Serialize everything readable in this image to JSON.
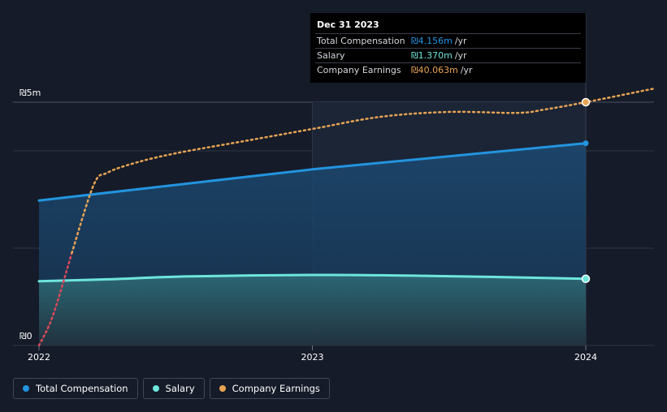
{
  "colors": {
    "background": "#151b28",
    "total": "#2394df",
    "salary": "#6ee6dc",
    "earnings": "#e9a453",
    "earnings_negative": "#e0475a",
    "grid": "#2d3445"
  },
  "tooltip": {
    "date": "Dec 31 2023",
    "rows": [
      {
        "label": "Total Compensation",
        "value": "₪4.156m",
        "unit": "/yr",
        "color": "#2394df"
      },
      {
        "label": "Salary",
        "value": "₪1.370m",
        "unit": "/yr",
        "color": "#6ee6dc"
      },
      {
        "label": "Company Earnings",
        "value": "₪40.063m",
        "unit": "/yr",
        "color": "#e9a453"
      }
    ]
  },
  "legend": [
    {
      "label": "Total Compensation",
      "color": "#2394df"
    },
    {
      "label": "Salary",
      "color": "#6ee6dc"
    },
    {
      "label": "Company Earnings",
      "color": "#e9a453"
    }
  ],
  "chart_data": {
    "type": "area",
    "title": "",
    "xlabel": "",
    "ylabel": "",
    "x_ticks": [
      "2022",
      "2023",
      "2024"
    ],
    "y_ticks": [
      "₪0",
      "₪5m"
    ],
    "y_tick_values": [
      0,
      5
    ],
    "xlim": [
      2022.0,
      2024.25
    ],
    "ylim": [
      0,
      5
    ],
    "grid": true,
    "legend_position": "bottom-left",
    "highlight_x": 2024.0,
    "series": [
      {
        "name": "Total Compensation",
        "x": [
          2022.0,
          2023.0,
          2024.0
        ],
        "y": [
          2.98,
          3.62,
          4.156
        ]
      },
      {
        "name": "Salary",
        "x": [
          2022.0,
          2022.25,
          2022.55,
          2023.0,
          2023.3,
          2023.65,
          2024.0
        ],
        "y": [
          1.32,
          1.36,
          1.42,
          1.45,
          1.44,
          1.41,
          1.37
        ]
      },
      {
        "name": "Company Earnings",
        "x": [
          2022.0,
          2022.05,
          2022.12,
          2022.2,
          2022.25,
          2022.35,
          2022.5,
          2022.75,
          2023.0,
          2023.25,
          2023.5,
          2023.75,
          2023.85,
          2024.0,
          2024.25
        ],
        "y": [
          0.0,
          0.6,
          1.9,
          3.3,
          3.55,
          3.75,
          3.95,
          4.2,
          4.45,
          4.7,
          4.8,
          4.78,
          4.85,
          5.0,
          5.28
        ],
        "negative_until": 2022.06
      }
    ]
  }
}
